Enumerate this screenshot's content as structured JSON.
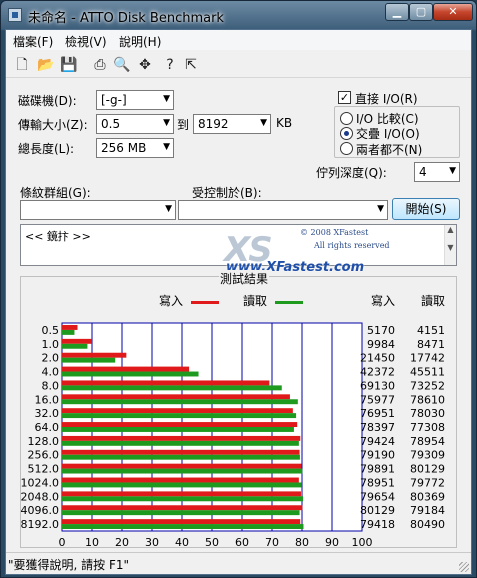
{
  "window": {
    "title": "未命名 - ATTO Disk Benchmark"
  },
  "menu": [
    "檔案(F)",
    "檢視(V)",
    "說明(H)"
  ],
  "toolbar_icons": [
    "new-icon",
    "open-icon",
    "save-icon",
    "print-icon",
    "print-preview-icon",
    "move-icon",
    "help-icon",
    "context-help-icon"
  ],
  "settings": {
    "drive_label": "磁碟機(D):",
    "drive_value": "[-g-]",
    "transfer_label": "傳輸大小(Z):",
    "transfer_min": "0.5",
    "transfer_to": "到",
    "transfer_max": "8192",
    "transfer_unit": "KB",
    "length_label": "總長度(L):",
    "length_value": "256 MB",
    "direct_io_label": "直接 I/O(R)",
    "io_compare_label": "I/O 比較(C)",
    "overlap_io_label": "交疊 I/O(O)",
    "neither_label": "兩者都不(N)",
    "queue_label": "佇列深度(Q):",
    "queue_value": "4",
    "pattern_label": "條紋群組(G):",
    "control_label": "受控制於(B):",
    "start_label": "開始(S)"
  },
  "memo": {
    "text": "<< 鏡抃 >>"
  },
  "watermark": {
    "logo": "XS",
    "copyright": "© 2008 XFastest",
    "rights": "All rights reserved",
    "url": "www.XFastest.com"
  },
  "results": {
    "title": "測試結果",
    "legend_write": "寫入",
    "legend_read": "讀取",
    "col_write": "寫入",
    "col_read": "讀取"
  },
  "chart_data": {
    "type": "bar",
    "orientation": "horizontal",
    "categories": [
      "0.5",
      "1.0",
      "2.0",
      "4.0",
      "8.0",
      "16.0",
      "32.0",
      "64.0",
      "128.0",
      "256.0",
      "512.0",
      "1024.0",
      "2048.0",
      "4096.0",
      "8192.0"
    ],
    "series": [
      {
        "name": "寫入",
        "color": "#e01a1a",
        "values": [
          5170,
          9984,
          21450,
          42372,
          69130,
          75977,
          76951,
          78397,
          79424,
          79190,
          79891,
          78951,
          79654,
          80129,
          79418
        ]
      },
      {
        "name": "讀取",
        "color": "#1e9a1e",
        "values": [
          4151,
          8471,
          17742,
          45511,
          73252,
          78610,
          78030,
          77308,
          78954,
          79309,
          80129,
          79772,
          80369,
          79184,
          80490
        ]
      }
    ],
    "xlabel": "傳輸速率 - MB / 秒",
    "xlim": [
      0,
      100
    ],
    "xticks": [
      "0",
      "10",
      "20",
      "30",
      "40",
      "50",
      "60",
      "70",
      "80",
      "90",
      "100"
    ],
    "grid": true
  },
  "status": {
    "text": "\"要獲得說明, 請按 F1\""
  }
}
